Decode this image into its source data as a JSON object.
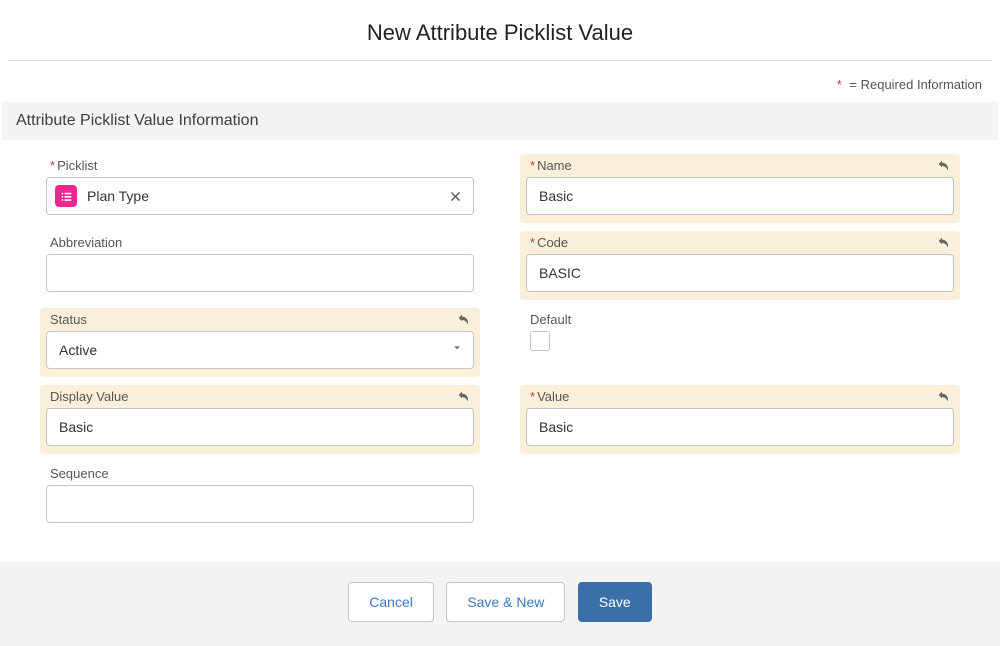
{
  "title": "New Attribute Picklist Value",
  "required_note": "= Required Information",
  "section_header": "Attribute Picklist Value Information",
  "labels": {
    "picklist": "Picklist",
    "name": "Name",
    "abbreviation": "Abbreviation",
    "code": "Code",
    "status": "Status",
    "default": "Default",
    "display_value": "Display Value",
    "value": "Value",
    "sequence": "Sequence"
  },
  "values": {
    "picklist": "Plan Type",
    "name": "Basic",
    "abbreviation": "",
    "code": "BASIC",
    "status": "Active",
    "default_checked": false,
    "display_value": "Basic",
    "value": "Basic",
    "sequence": ""
  },
  "buttons": {
    "cancel": "Cancel",
    "save_new": "Save & New",
    "save": "Save"
  }
}
